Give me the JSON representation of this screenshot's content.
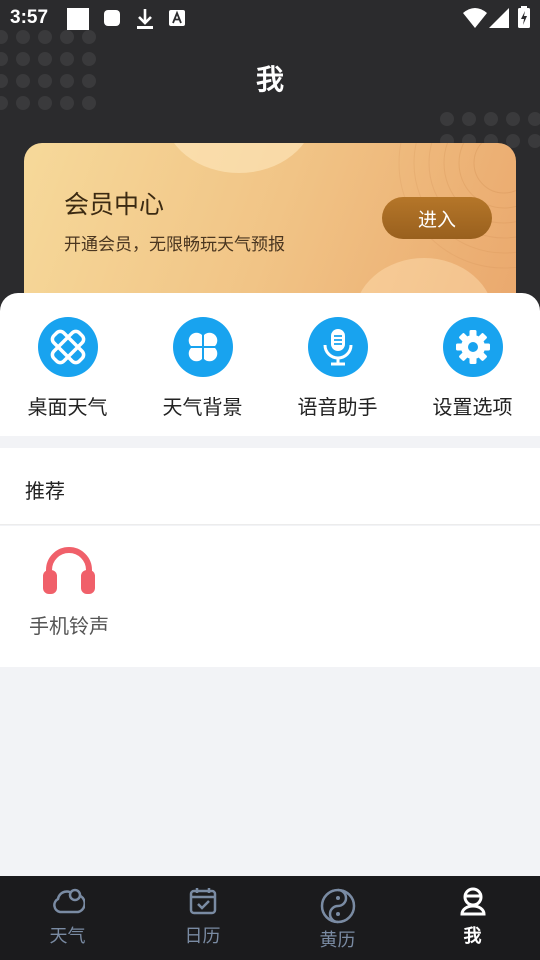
{
  "status_bar": {
    "time": "3:57"
  },
  "header": {
    "title": "我"
  },
  "vip": {
    "title": "会员中心",
    "subtitle": "开通会员，无限畅玩天气预报",
    "button": "进入"
  },
  "features": [
    {
      "label": "桌面天气",
      "icon": "widget-icon"
    },
    {
      "label": "天气背景",
      "icon": "clover-icon"
    },
    {
      "label": "语音助手",
      "icon": "microphone-icon"
    },
    {
      "label": "设置选项",
      "icon": "gear-icon"
    }
  ],
  "recommend": {
    "title": "推荐",
    "items": [
      {
        "label": "手机铃声",
        "icon": "headphones-icon",
        "color": "#f0606a"
      }
    ]
  },
  "bottom_nav": [
    {
      "label": "天气",
      "icon": "cloud-icon",
      "active": false
    },
    {
      "label": "日历",
      "icon": "calendar-icon",
      "active": false
    },
    {
      "label": "黄历",
      "icon": "yin-yang-icon",
      "active": false
    },
    {
      "label": "我",
      "icon": "person-icon",
      "active": true
    }
  ],
  "colors": {
    "accent": "#18a3ef",
    "header_bg": "#2b2b2d",
    "nav_bg": "#1b1b1d"
  }
}
